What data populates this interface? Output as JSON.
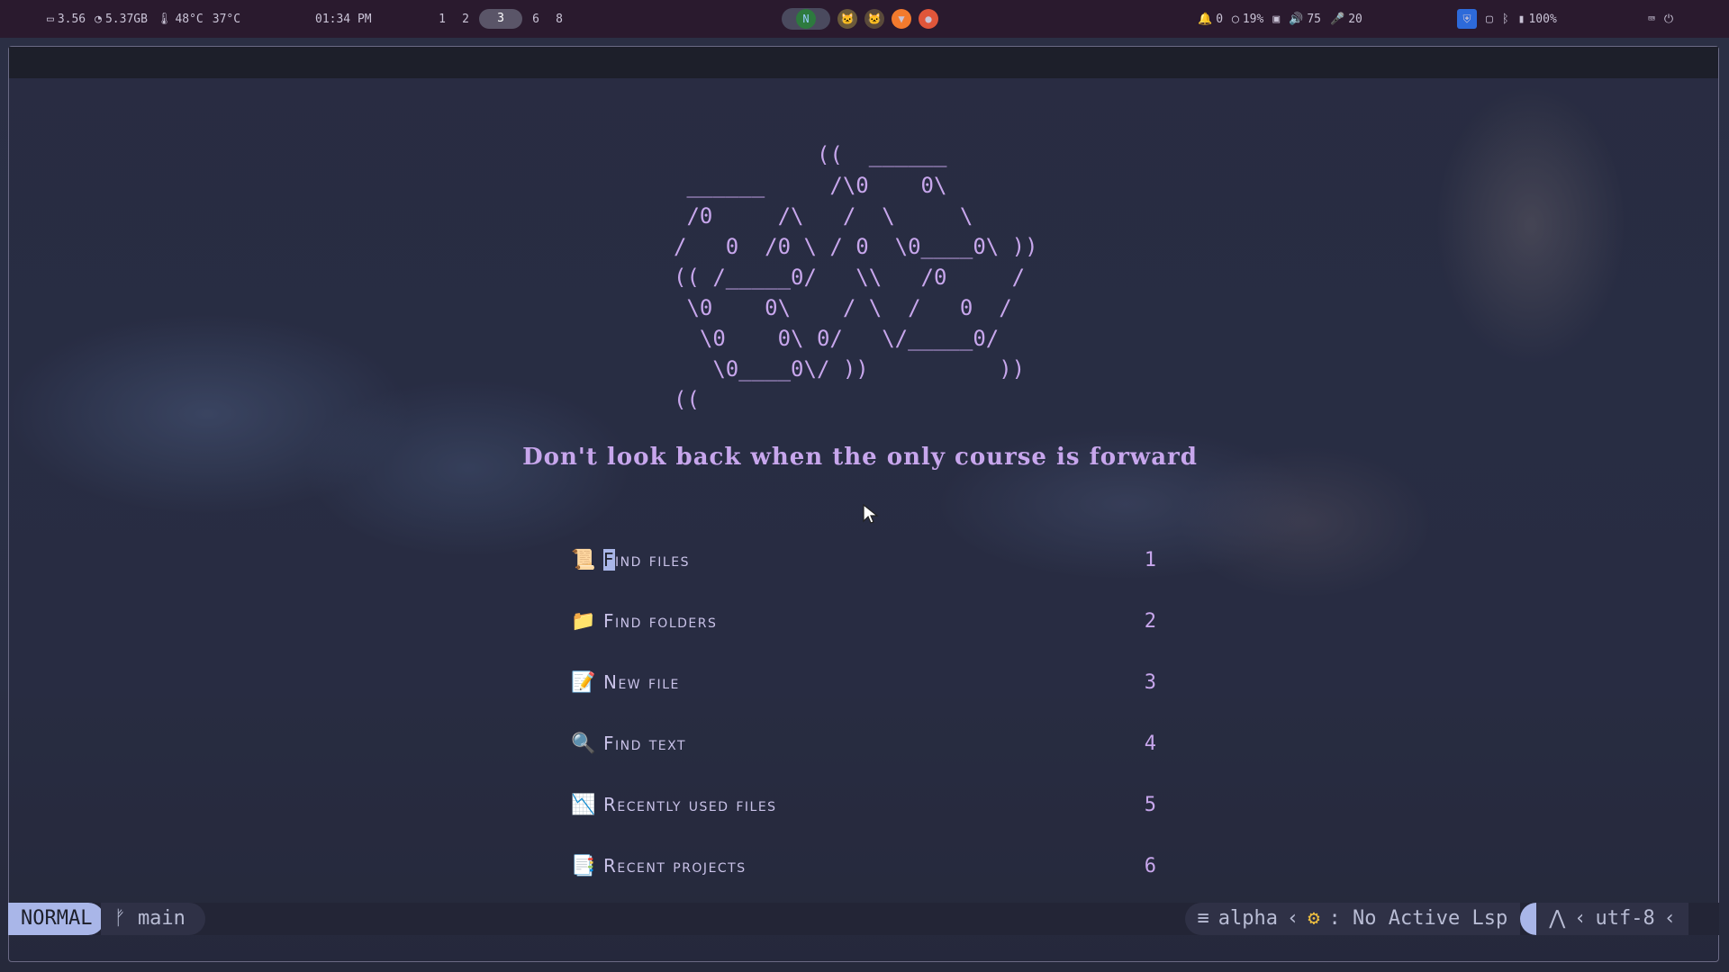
{
  "topbar": {
    "cpu": "3.56",
    "mem": "5.37GB",
    "temp1": "48°C",
    "temp2": "37°C",
    "clock": "01:34 PM",
    "workspaces": [
      "1",
      "2",
      "3",
      "6",
      "8"
    ],
    "active_workspace": "3",
    "notifications": "0",
    "brightness": "19%",
    "volume": "75",
    "mic": "20",
    "battery": "100%"
  },
  "ascii_art": [
    "           ((  ______",
    " ______     /\\0    0\\",
    " /0     /\\   /  \\     \\",
    "/   0  /0 \\ / 0  \\0____0\\ ))",
    "(( /_____0/   \\\\   /0     /",
    " \\0    0\\    / \\  /   0  /",
    "  \\0    0\\ 0/   \\/_____0/",
    "   \\0____0\\/ ))          ))",
    "((  "
  ],
  "quote": "Don't look back when the only course is forward",
  "menu": [
    {
      "icon": "📜",
      "label": "Find files",
      "key": "1"
    },
    {
      "icon": "📁",
      "label": "Find folders",
      "key": "2"
    },
    {
      "icon": "📝",
      "label": "New file",
      "key": "3"
    },
    {
      "icon": "🔍",
      "label": "Find text",
      "key": "4"
    },
    {
      "icon": "📉",
      "label": "Recently used files",
      "key": "5"
    },
    {
      "icon": "📑",
      "label": "Recent projects",
      "key": "6"
    }
  ],
  "statusline": {
    "mode": "NORMAL",
    "branch": "main",
    "filetype": "alpha",
    "lsp": ": No Active Lsp",
    "encoding": "utf-8"
  }
}
